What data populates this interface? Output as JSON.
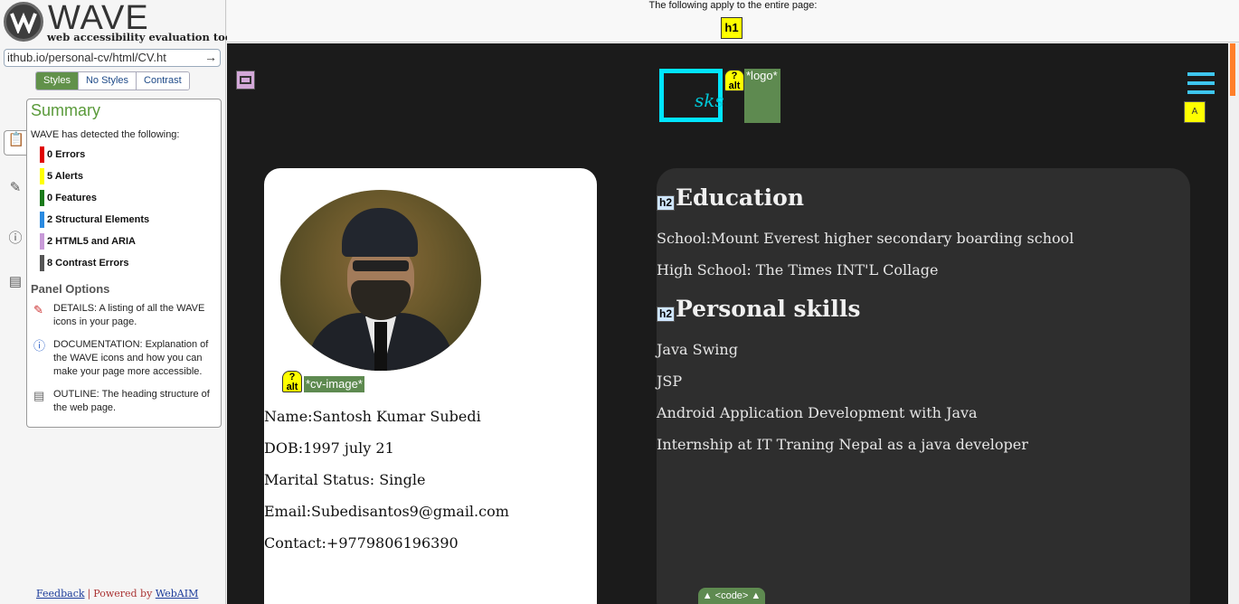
{
  "wave": {
    "logo_text": "WAVE",
    "tagline": "web accessibility evaluation tool",
    "url": "ithub.io/personal-cv/html/CV.ht",
    "url_go_icon": "arrow-right-icon",
    "views": [
      "Styles",
      "No Styles",
      "Contrast"
    ],
    "active_view": "Styles",
    "panel_tab_icons": [
      "clipboard-icon",
      "flag-icon",
      "info-icon",
      "outline-icon"
    ],
    "summary": {
      "title": "Summary",
      "intro": "WAVE has detected the following:",
      "stats": [
        {
          "label": "0 Errors",
          "color": "#e00000"
        },
        {
          "label": "5 Alerts",
          "color": "#ffff00"
        },
        {
          "label": "0 Features",
          "color": "#1a7a1a"
        },
        {
          "label": "2 Structural Elements",
          "color": "#2a8ae0"
        },
        {
          "label": "2 HTML5 and ARIA",
          "color": "#c89ad8"
        },
        {
          "label": "8 Contrast Errors",
          "color": "#555555"
        }
      ],
      "panel_options_title": "Panel Options",
      "options": [
        {
          "icon": "flag-icon",
          "text": "DETAILS: A listing of all the WAVE icons in your page."
        },
        {
          "icon": "info-icon",
          "text": "DOCUMENTATION: Explanation of the WAVE icons and how you can make your page more accessible."
        },
        {
          "icon": "outline-icon",
          "text": "OUTLINE: The heading structure of the web page."
        }
      ]
    },
    "footer": {
      "feedback": "Feedback",
      "separator": "|",
      "powered_by": "Powered by",
      "webaim": "WebAIM"
    }
  },
  "topbar": {
    "text": "The following apply to the entire page:",
    "h1_badge": "h1"
  },
  "page": {
    "logo_text": "sks",
    "logo_alt_icon": "alt-missing-icon",
    "logo_alt_label": "*logo*",
    "cv_image_alt_label": "*cv-image*",
    "alt_icon_top": "?",
    "alt_icon_bottom": "alt",
    "personal_info": [
      "Name:Santosh Kumar Subedi",
      "DOB:1997 july 21",
      "Marital Status: Single",
      "Email:Subedisantos9@gmail.com",
      "Contact:+9779806196390"
    ],
    "h2_badge": "h2",
    "education": {
      "title": "Education",
      "items": [
        "School:Mount Everest higher secondary boarding school",
        "High School: The Times INT'L Collage"
      ]
    },
    "skills": {
      "title": "Personal skills",
      "items": [
        "Java Swing",
        "JSP",
        "Android Application Development with Java",
        "Internship at IT Traning Nepal as a java developer"
      ]
    },
    "code_toggle": "▲ <code> ▲",
    "hamburger_flag": "A"
  }
}
